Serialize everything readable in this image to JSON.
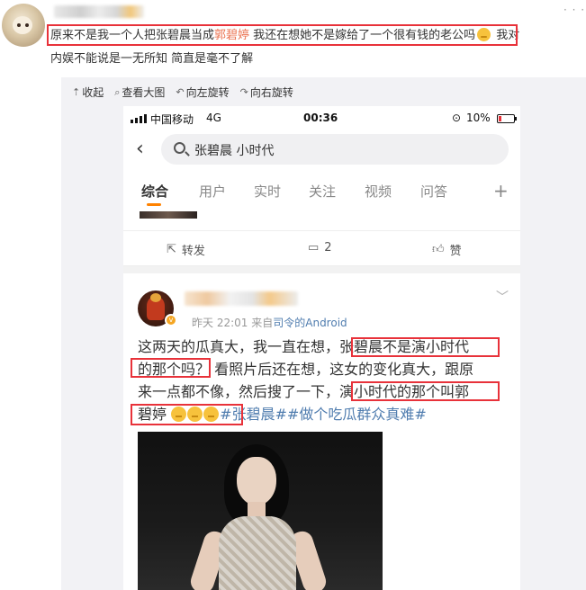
{
  "comment": {
    "line1_before": "原来不是我一个人把张碧晨当成",
    "line1_link": "郭碧婷",
    "line1_after": " 我还在想她不是嫁给了一个很有钱的老公吗",
    "line1_tail": " 我对",
    "line2": "内娱不能说是一无所知 简直是毫不了解",
    "more": "· · ·"
  },
  "toolbar": {
    "collapse": "收起",
    "view_large": "查看大图",
    "rotate_left": "向左旋转",
    "rotate_right": "向右旋转"
  },
  "status_bar": {
    "carrier": "中国移动",
    "network": "4G",
    "time": "00:36",
    "battery": "10%"
  },
  "search": {
    "query": "张碧晨 小时代"
  },
  "tabs": [
    "综合",
    "用户",
    "实时",
    "关注",
    "视频",
    "问答"
  ],
  "post_actions": {
    "repost": "转发",
    "comments": "2",
    "like": "赞"
  },
  "post": {
    "time": "昨天 22:01",
    "from_prefix": "来自",
    "source": "司令的Android",
    "line1": "这两天的瓜真大，我一直在想，张碧晨不是演小时代",
    "line2": "的那个吗？ 看照片后还在想，这女的变化真大，跟原",
    "line3": "来一点都不像，然后搜了一下，演小时代的那个叫郭",
    "line4_text": "碧婷",
    "line4_tags": "#张碧晨##做个吃瓜群众真难#"
  },
  "colors": {
    "highlight_box": "#e8323a",
    "link": "#507daf",
    "comment_link": "#eb7350",
    "tab_underline": "#ff8200"
  }
}
